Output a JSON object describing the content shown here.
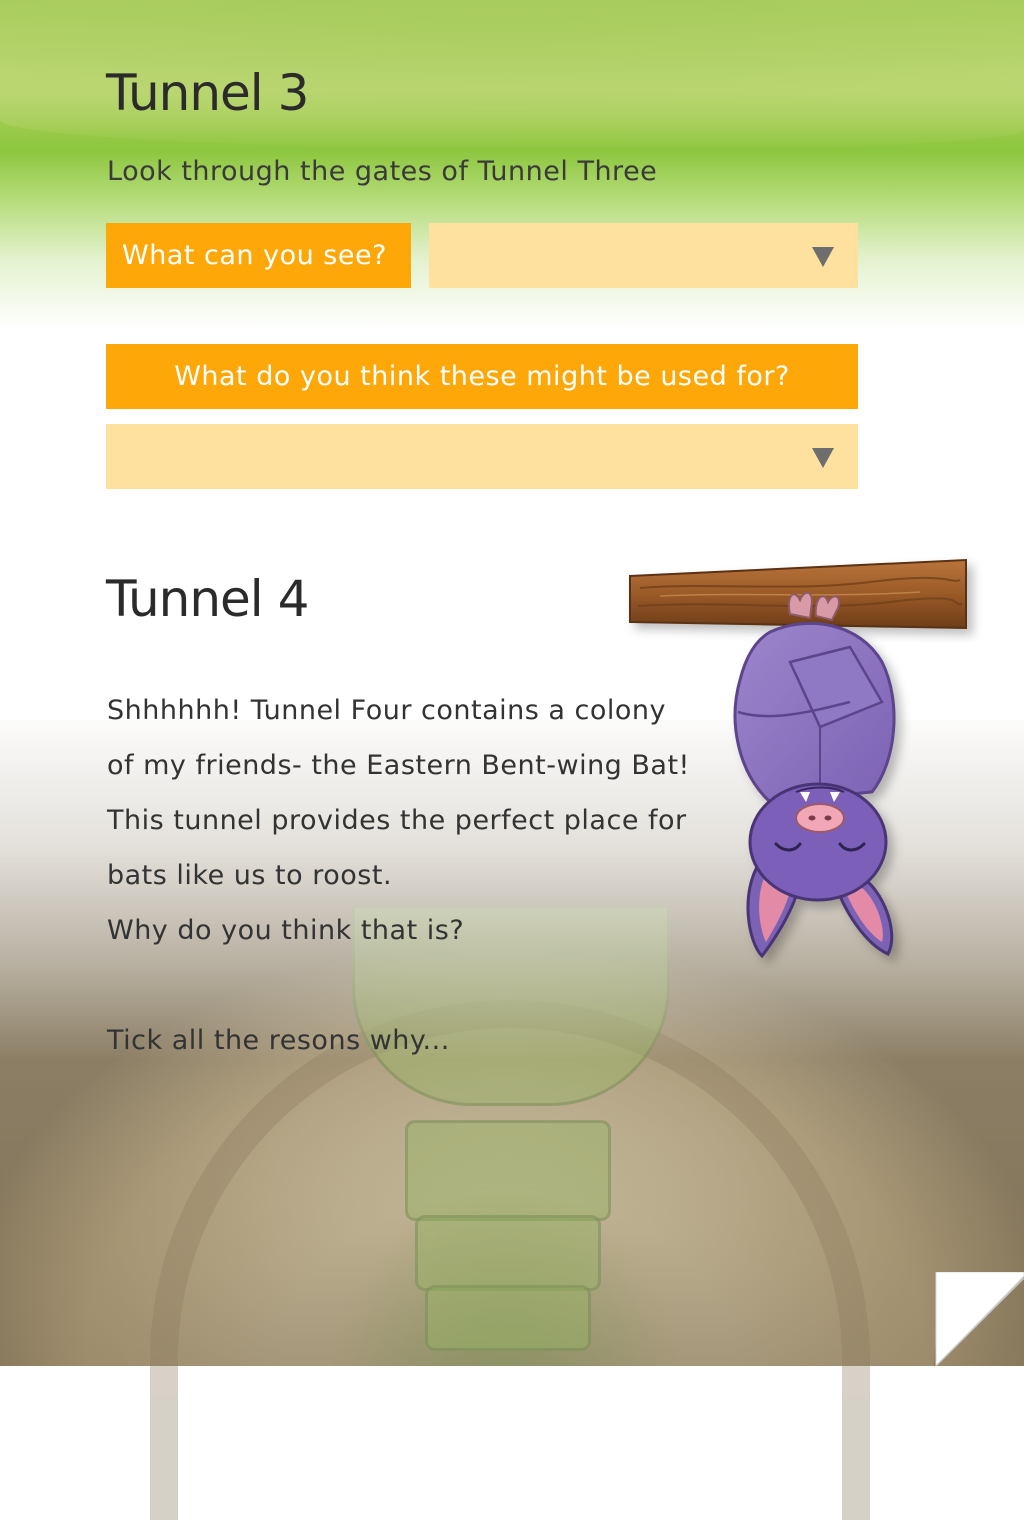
{
  "tunnel3": {
    "heading": "Tunnel 3",
    "intro": "Look through the gates of Tunnel Three",
    "question1": {
      "label": "What can you see?",
      "selected": ""
    },
    "question2": {
      "label": "What do you think these might be used for?",
      "selected": ""
    }
  },
  "tunnel4": {
    "heading": "Tunnel 4",
    "lines": [
      "Shhhhhh! Tunnel Four contains a colony",
      "of my friends- the Eastern Bent-wing Bat!",
      "This tunnel provides the perfect place for",
      "bats like us to roost.",
      "Why do you think that is?"
    ],
    "prompt": "Tick all the resons why..."
  },
  "icons": {
    "dropdown": "chevron-down-icon",
    "mascot": "bat-mascot-icon",
    "branch": "wooden-branch-icon",
    "page_turn": "page-curl-icon"
  },
  "colors": {
    "label_orange": "#fda709",
    "select_peach": "#fee09f",
    "bat_purple": "#8a6fc0",
    "branch_brown": "#9a5a28"
  }
}
